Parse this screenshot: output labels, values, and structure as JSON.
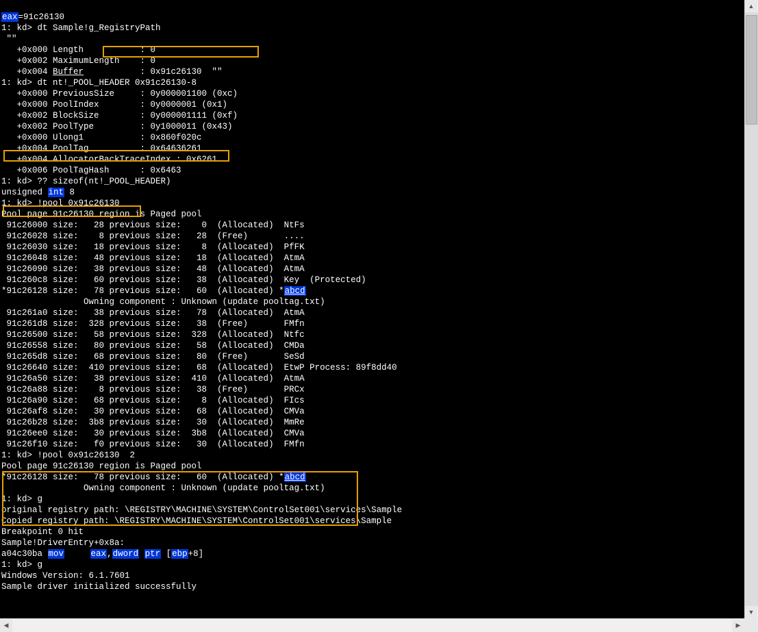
{
  "l0_a": "eax",
  "l0_b": "=91c26130",
  "l1": "1: kd> dt Sample!g_RegistryPath",
  "l2": " \"\"",
  "l3": "   +0x000 Length           : 0",
  "l4": "   +0x002 MaximumLength    : 0",
  "l5_a": "   +0x004 ",
  "l5_b": "Buffer",
  "l5_c": "           : 0x91c26130  \"\"",
  "l6": "1: kd> dt nt!_POOL_HEADER 0x91c26130-8",
  "l7": "   +0x000 PreviousSize     : 0y000001100 (0xc)",
  "l8": "   +0x000 PoolIndex        : 0y0000001 (0x1)",
  "l9": "   +0x002 BlockSize        : 0y000001111 (0xf)",
  "l10": "   +0x002 PoolType         : 0y1000011 (0x43)",
  "l11": "   +0x000 Ulong1           : 0x860f020c",
  "l12": "   +0x004 PoolTag          : 0x64636261",
  "l13": "   +0x004 AllocatorBackTraceIndex : 0x6261",
  "l14": "   +0x006 PoolTagHash      : 0x6463",
  "l15": "1: kd> ?? sizeof(nt!_POOL_HEADER)",
  "l16_a": "unsigned ",
  "l16_b": "int",
  "l16_c": " 8",
  "l17": "1: kd> !pool 0x91c26130",
  "l18": "Pool page 91c26130 region is Paged pool",
  "p0": " 91c26000 size:   28 previous size:    0  (Allocated)  NtFs",
  "p1": " 91c26028 size:    8 previous size:   28  (Free)       ....",
  "p2": " 91c26030 size:   18 previous size:    8  (Allocated)  PfFK",
  "p3": " 91c26048 size:   48 previous size:   18  (Allocated)  AtmA",
  "p4": " 91c26090 size:   38 previous size:   48  (Allocated)  AtmA",
  "p5": " 91c260c8 size:   60 previous size:   38  (Allocated)  Key  (Protected)",
  "p6_a": "*91c26128 size:   78 previous size:   60  (Allocated) *",
  "p6_b": "abcd",
  "p7": "\t\tOwning component : Unknown (update pooltag.txt)",
  "p8": " 91c261a0 size:   38 previous size:   78  (Allocated)  AtmA",
  "p9": " 91c261d8 size:  328 previous size:   38  (Free)       FMfn",
  "p10": " 91c26500 size:   58 previous size:  328  (Allocated)  Ntfc",
  "p11": " 91c26558 size:   80 previous size:   58  (Allocated)  CMDa",
  "p12": " 91c265d8 size:   68 previous size:   80  (Free)       SeSd",
  "p13": " 91c26640 size:  410 previous size:   68  (Allocated)  EtwP Process: 89f8dd40",
  "p14": " 91c26a50 size:   38 previous size:  410  (Allocated)  AtmA",
  "p15": " 91c26a88 size:    8 previous size:   38  (Free)       PRCx",
  "p16": " 91c26a90 size:   68 previous size:    8  (Allocated)  FIcs",
  "p17": " 91c26af8 size:   30 previous size:   68  (Allocated)  CMVa",
  "p18": " 91c26b28 size:  3b8 previous size:   30  (Allocated)  MmRe",
  "p19": " 91c26ee0 size:   30 previous size:  3b8  (Allocated)  CMVa",
  "p20": " 91c26f10 size:   f0 previous size:   30  (Allocated)  FMfn",
  "l30": "1: kd> !pool 0x91c26130  2",
  "l31": "Pool page 91c26130 region is Paged pool",
  "l32_a": "*91c26128 size:   78 previous size:   60  (Allocated) *",
  "l32_b": "abcd",
  "l33": "\t\tOwning component : Unknown (update pooltag.txt)",
  "l34": "1: kd> g",
  "l35": "original registry path: \\REGISTRY\\MACHINE\\SYSTEM\\ControlSet001\\services\\Sample",
  "l36": "Copied registry path: \\REGISTRY\\MACHINE\\SYSTEM\\ControlSet001\\services\\Sample",
  "l37": "Breakpoint 0 hit",
  "l38": "Sample!DriverEntry+0x8a:",
  "l39_a": "a04c30ba ",
  "l39_mov": "mov",
  "l39_sp1": "     ",
  "l39_eax": "eax",
  "l39_c1": ",",
  "l39_dw": "dword",
  "l39_sp2": " ",
  "l39_ptr": "ptr",
  "l39_br1": " [",
  "l39_ebp": "ebp",
  "l39_br2": "+8]",
  "l40": "1: kd> g",
  "l41": "Windows Version: 6.1.7601",
  "l42": "Sample driver initialized successfully",
  "arrows": {
    "up": "▲",
    "down": "▼",
    "left": "◀",
    "right": "▶"
  }
}
